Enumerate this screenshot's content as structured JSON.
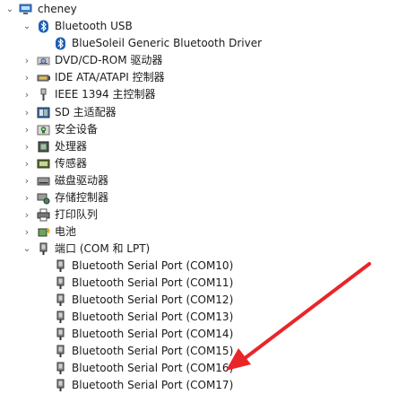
{
  "tree": {
    "root": {
      "label": "cheney",
      "icon": "computer-icon"
    },
    "nodes": [
      {
        "label": "Bluetooth USB",
        "icon": "bluetooth-icon",
        "state": "expanded"
      },
      {
        "label": "BlueSoleil Generic Bluetooth Driver",
        "icon": "bluetooth-icon"
      },
      {
        "label": "DVD/CD-ROM 驱动器",
        "icon": "optical-drive-icon",
        "state": "collapsed"
      },
      {
        "label": "IDE ATA/ATAPI 控制器",
        "icon": "ide-controller-icon",
        "state": "collapsed"
      },
      {
        "label": "IEEE 1394 主控制器",
        "icon": "ieee1394-icon",
        "state": "collapsed"
      },
      {
        "label": "SD 主适配器",
        "icon": "sd-adapter-icon",
        "state": "collapsed"
      },
      {
        "label": "安全设备",
        "icon": "security-device-icon",
        "state": "collapsed"
      },
      {
        "label": "处理器",
        "icon": "processor-icon",
        "state": "collapsed"
      },
      {
        "label": "传感器",
        "icon": "sensor-icon",
        "state": "collapsed"
      },
      {
        "label": "磁盘驱动器",
        "icon": "disk-drive-icon",
        "state": "collapsed"
      },
      {
        "label": "存储控制器",
        "icon": "storage-controller-icon",
        "state": "collapsed"
      },
      {
        "label": "打印队列",
        "icon": "printer-icon",
        "state": "collapsed"
      },
      {
        "label": "电池",
        "icon": "battery-icon",
        "state": "collapsed"
      },
      {
        "label": "端口 (COM 和 LPT)",
        "icon": "port-icon",
        "state": "expanded"
      },
      {
        "label": "Bluetooth Serial Port (COM10)",
        "icon": "serial-port-icon"
      },
      {
        "label": "Bluetooth Serial Port (COM11)",
        "icon": "serial-port-icon"
      },
      {
        "label": "Bluetooth Serial Port (COM12)",
        "icon": "serial-port-icon"
      },
      {
        "label": "Bluetooth Serial Port (COM13)",
        "icon": "serial-port-icon"
      },
      {
        "label": "Bluetooth Serial Port (COM14)",
        "icon": "serial-port-icon"
      },
      {
        "label": "Bluetooth Serial Port (COM15)",
        "icon": "serial-port-icon"
      },
      {
        "label": "Bluetooth Serial Port (COM16)",
        "icon": "serial-port-icon"
      },
      {
        "label": "Bluetooth Serial Port (COM17)",
        "icon": "serial-port-icon"
      }
    ]
  },
  "annotation": {
    "icon": "red-arrow-icon",
    "color": "#e8262a"
  }
}
